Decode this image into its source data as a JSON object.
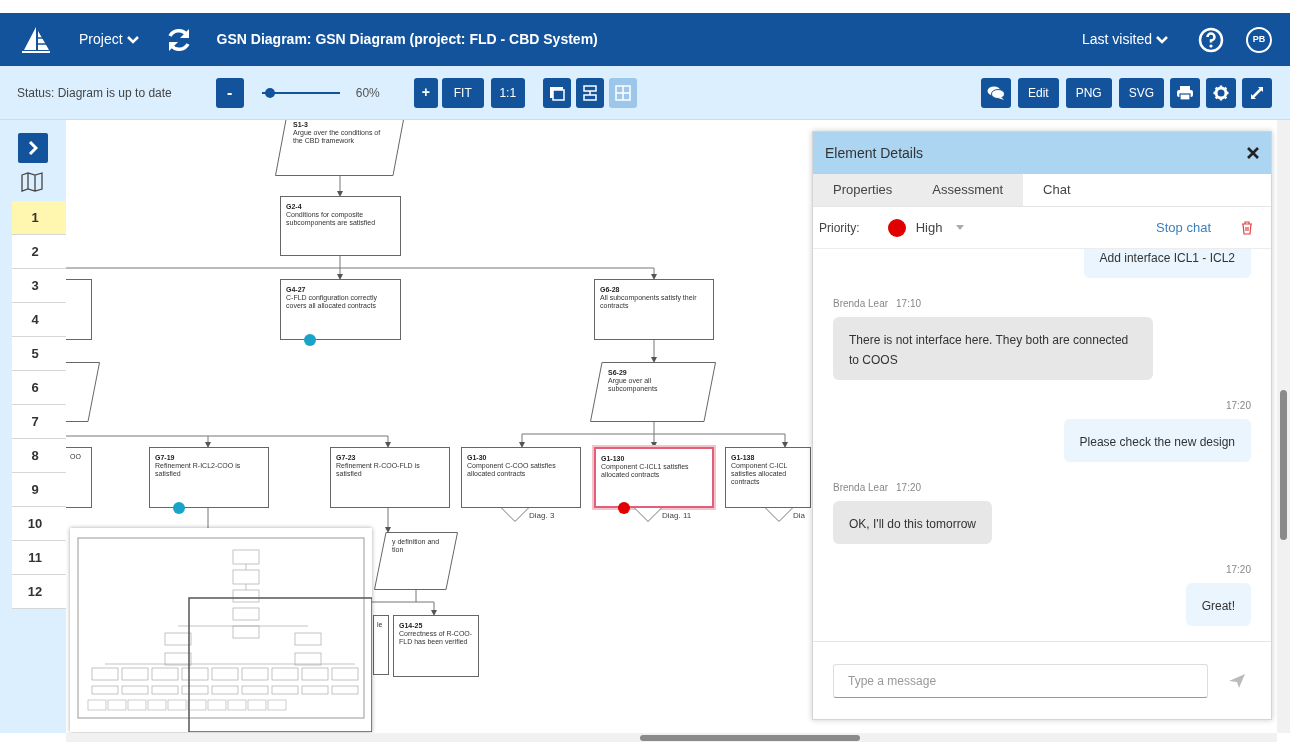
{
  "header": {
    "project_menu": "Project",
    "title": "GSN Diagram: GSN Diagram (project: FLD - CBD System)",
    "last_visited": "Last visited",
    "user_initials": "PB"
  },
  "toolbar": {
    "status": "Status: Diagram is up to date",
    "zoom_out": "-",
    "zoom": {
      "level": 0.05,
      "reading": "60%"
    },
    "zoom_in": "+",
    "fit": "FIT",
    "actual_size": "1:1",
    "layout_buttons": [
      {
        "disabled": false
      },
      {
        "disabled": false
      },
      {
        "disabled": true
      }
    ],
    "export_buttons": [
      "Edit",
      "PNG",
      "SVG"
    ]
  },
  "sidebar": {
    "rows": [
      {
        "label": "1",
        "selected": true
      },
      {
        "label": "2",
        "selected": false
      },
      {
        "label": "3",
        "selected": false
      },
      {
        "label": "4",
        "selected": false
      },
      {
        "label": "5",
        "selected": false
      },
      {
        "label": "6",
        "selected": false
      },
      {
        "label": "7",
        "selected": false
      },
      {
        "label": "8",
        "selected": false
      },
      {
        "label": "9",
        "selected": false
      },
      {
        "label": "10",
        "selected": false
      },
      {
        "label": "11",
        "selected": false
      },
      {
        "label": "12",
        "selected": false
      }
    ]
  },
  "diagram": {
    "nodes": [
      {
        "kind": "strategy",
        "id": "S1-3",
        "text": "Argue over the conditions of the CBD framework",
        "selected": false
      },
      {
        "kind": "goal",
        "id": "G2-4",
        "text": "Conditions for composite subcomponents are satisfied",
        "selected": false
      },
      {
        "kind": "goal",
        "id": "G4-27",
        "text": "C-FLD configuration correctly covers all allocated contracts",
        "selected": false,
        "color": "#1aa3c8"
      },
      {
        "kind": "goal",
        "id": "G6-28",
        "text": "All subcomponents satisfy their contracts",
        "selected": false
      },
      {
        "kind": "strategy",
        "id": "S6-29",
        "text": "Argue over all subcomponents",
        "selected": false
      },
      {
        "kind": "goal",
        "selected": false
      },
      {
        "kind": "strategy",
        "selected": false
      },
      {
        "kind": "goal",
        "text": "OO",
        "selected": false
      },
      {
        "kind": "goal",
        "id": "G7-19",
        "text": "Refinement R-ICL2-COO is satisfied",
        "selected": false,
        "color": "#1aa3c8"
      },
      {
        "kind": "goal",
        "id": "G7-23",
        "text": "Refinement R-COO-FLD is satisfied",
        "selected": false
      },
      {
        "kind": "goal",
        "id": "G1-30",
        "text": "Component C-COO satisfies allocated contracts",
        "selected": false,
        "module_ref": "Diag. 3"
      },
      {
        "kind": "goal",
        "id": "G1-130",
        "text": "Component C-ICL1 satisfies allocated contracts",
        "selected": true,
        "color": "#e00000",
        "module_ref": "Diag. 11"
      },
      {
        "kind": "goal",
        "id": "G1-138",
        "text": "Component C-ICL satisfies allocated contracts",
        "selected": false,
        "module_ref": "Dia"
      },
      {
        "kind": "strategy",
        "text": "y definition and tion",
        "selected": false
      },
      {
        "kind": "goal",
        "text": "le",
        "selected": false
      },
      {
        "kind": "goal",
        "id": "G14-25",
        "text": "Correctness of R-COO-FLD has been verified",
        "selected": false
      }
    ]
  },
  "details_panel": {
    "title": "Element Details",
    "tabs": [
      {
        "label": "Properties",
        "selected": false
      },
      {
        "label": "Assessment",
        "selected": false
      },
      {
        "label": "Chat",
        "selected": true
      }
    ],
    "priority_label": "Priority:",
    "priority": {
      "label": "High",
      "color": "#e00000"
    },
    "stop_chat": "Stop chat",
    "messages": [
      {
        "kind": "sent",
        "text": "Add interface ICL1 - ICL2"
      },
      {
        "kind": "received",
        "author": "Brenda Lear",
        "time": "17:10",
        "text": "There is not interface here. They both are connected to COOS"
      },
      {
        "kind": "sent",
        "time": "17:20",
        "text": "Please check the new design"
      },
      {
        "kind": "received",
        "author": "Brenda Lear",
        "time": "17:20",
        "text": "OK, I'll do this tomorrow"
      },
      {
        "kind": "sent",
        "time": "17:20",
        "text": "Great!"
      }
    ],
    "message_input": {
      "placeholder": "Type a message"
    }
  }
}
